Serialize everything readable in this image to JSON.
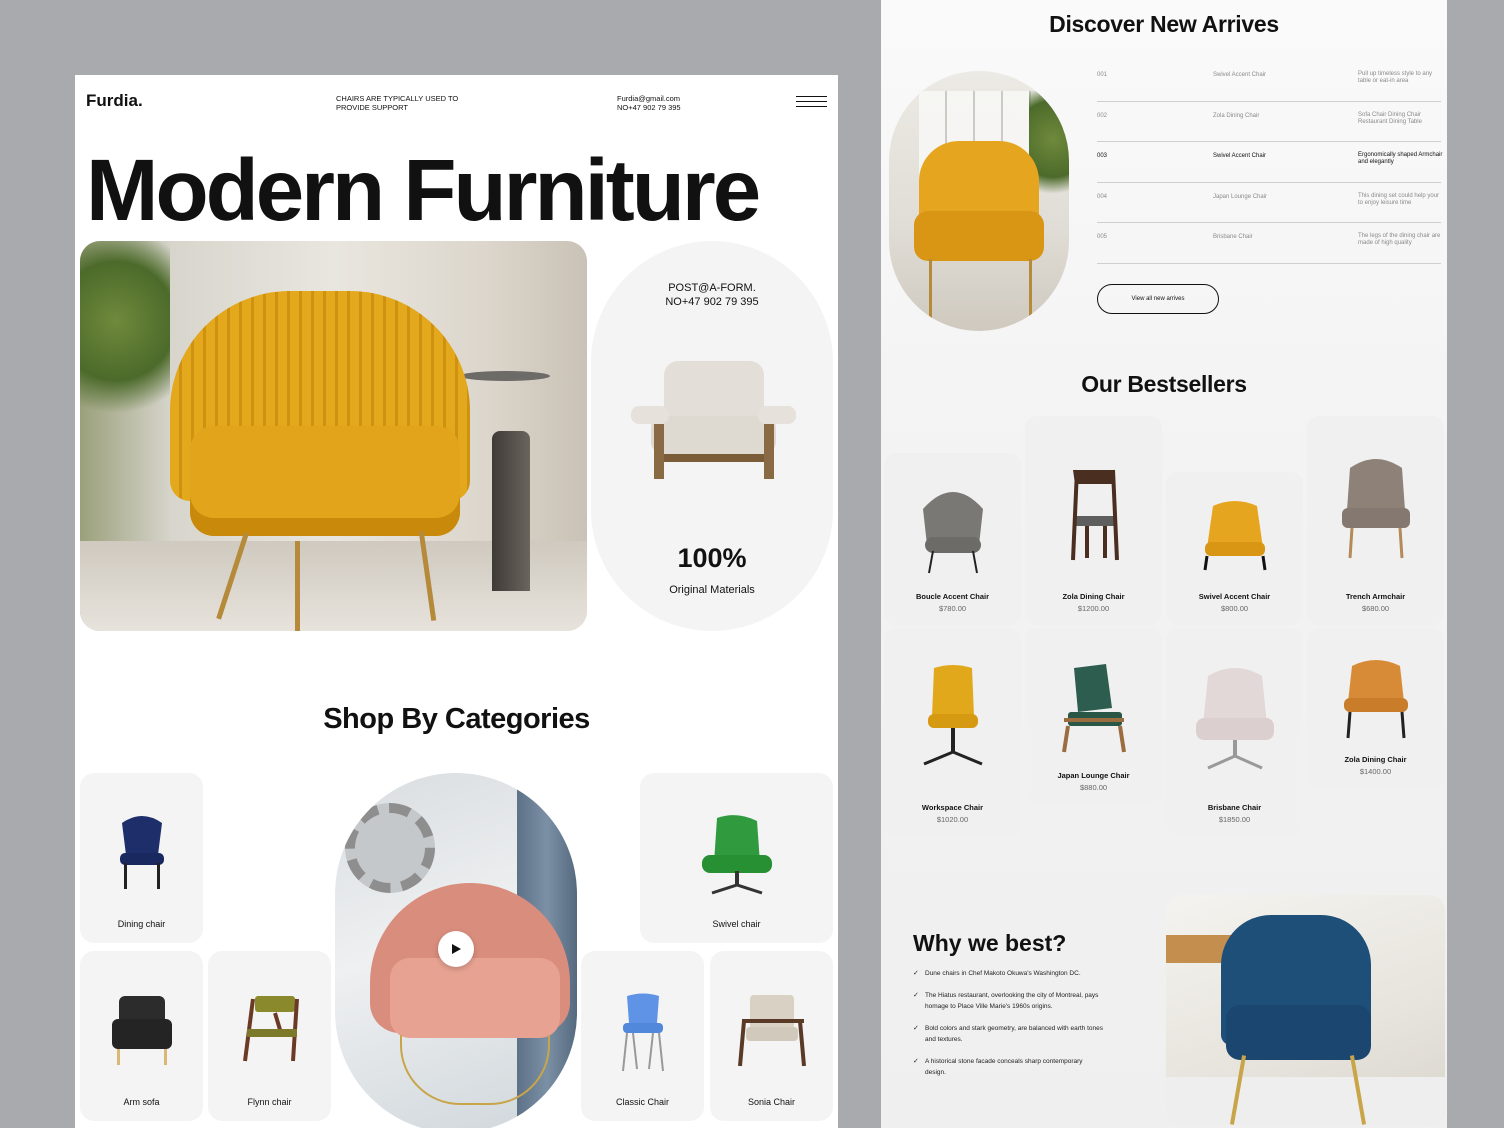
{
  "header": {
    "brand": "Furdia.",
    "tagline": "CHAIRS ARE TYPICALLY USED TO PROVIDE SUPPORT",
    "email": "Furdia@gmail.com",
    "phone": "NO+47 902 79 395"
  },
  "hero": {
    "title": "Modern Furniture",
    "promo_line1": "POST@A-FORM.",
    "promo_line2": "NO+47 902 79 395",
    "stat_value": "100%",
    "stat_label": "Original Materials"
  },
  "categories": {
    "title": "Shop By Categories",
    "items": [
      {
        "label": "Dining chair"
      },
      {
        "label": "Swivel chair"
      },
      {
        "label": "Arm sofa"
      },
      {
        "label": "Flynn chair"
      },
      {
        "label": "Classic Chair"
      },
      {
        "label": "Sonia Chair"
      }
    ]
  },
  "new_arrivals": {
    "title": "Discover New Arrives",
    "rows": [
      {
        "num": "001",
        "name": "Swivel Accent Chair",
        "desc": "Pull up timeless style to any table or eat-in area"
      },
      {
        "num": "002",
        "name": "Zola Dining Chair",
        "desc": "Sofa Chair Dining Chair Restaurant Dining Table"
      },
      {
        "num": "003",
        "name": "Swivel Accent Chair",
        "desc": "Ergonomically shaped Armchair and elegantly"
      },
      {
        "num": "004",
        "name": "Japan Lounge Chair",
        "desc": "This dining set could help your to enjoy leisure time"
      },
      {
        "num": "005",
        "name": "Brisbane Chair",
        "desc": "The legs of the dining chair are made of high quality"
      }
    ],
    "button": "View all new arrives"
  },
  "bestsellers": {
    "title": "Our Bestsellers",
    "items": [
      {
        "name": "Boucle Accent Chair",
        "price": "$780.00"
      },
      {
        "name": "Zola Dining Chair",
        "price": "$1200.00"
      },
      {
        "name": "Swivel Accent Chair",
        "price": "$800.00"
      },
      {
        "name": "Trench Armchair",
        "price": "$680.00"
      },
      {
        "name": "Workspace Chair",
        "price": "$1020.00"
      },
      {
        "name": "Japan Lounge Chair",
        "price": "$880.00"
      },
      {
        "name": "Brisbane Chair",
        "price": "$1850.00"
      },
      {
        "name": "Zola Dining Chair",
        "price": "$1400.00"
      }
    ]
  },
  "why": {
    "title": "Why we best?",
    "points": [
      "Dune chairs in Chef Makoto Okuwa's Washington DC.",
      "The Hiatus restaurant, overlooking the city of Montreal, pays homage to Place Ville Marie's 1960s origins.",
      "Bold colors and stark geometry, are balanced with earth tones and textures.",
      "A historical stone facade conceals sharp contemporary design."
    ]
  },
  "colors": {
    "background": "#a9aaad",
    "mustard": "#e2a41a",
    "card": "#f4f4f4"
  }
}
